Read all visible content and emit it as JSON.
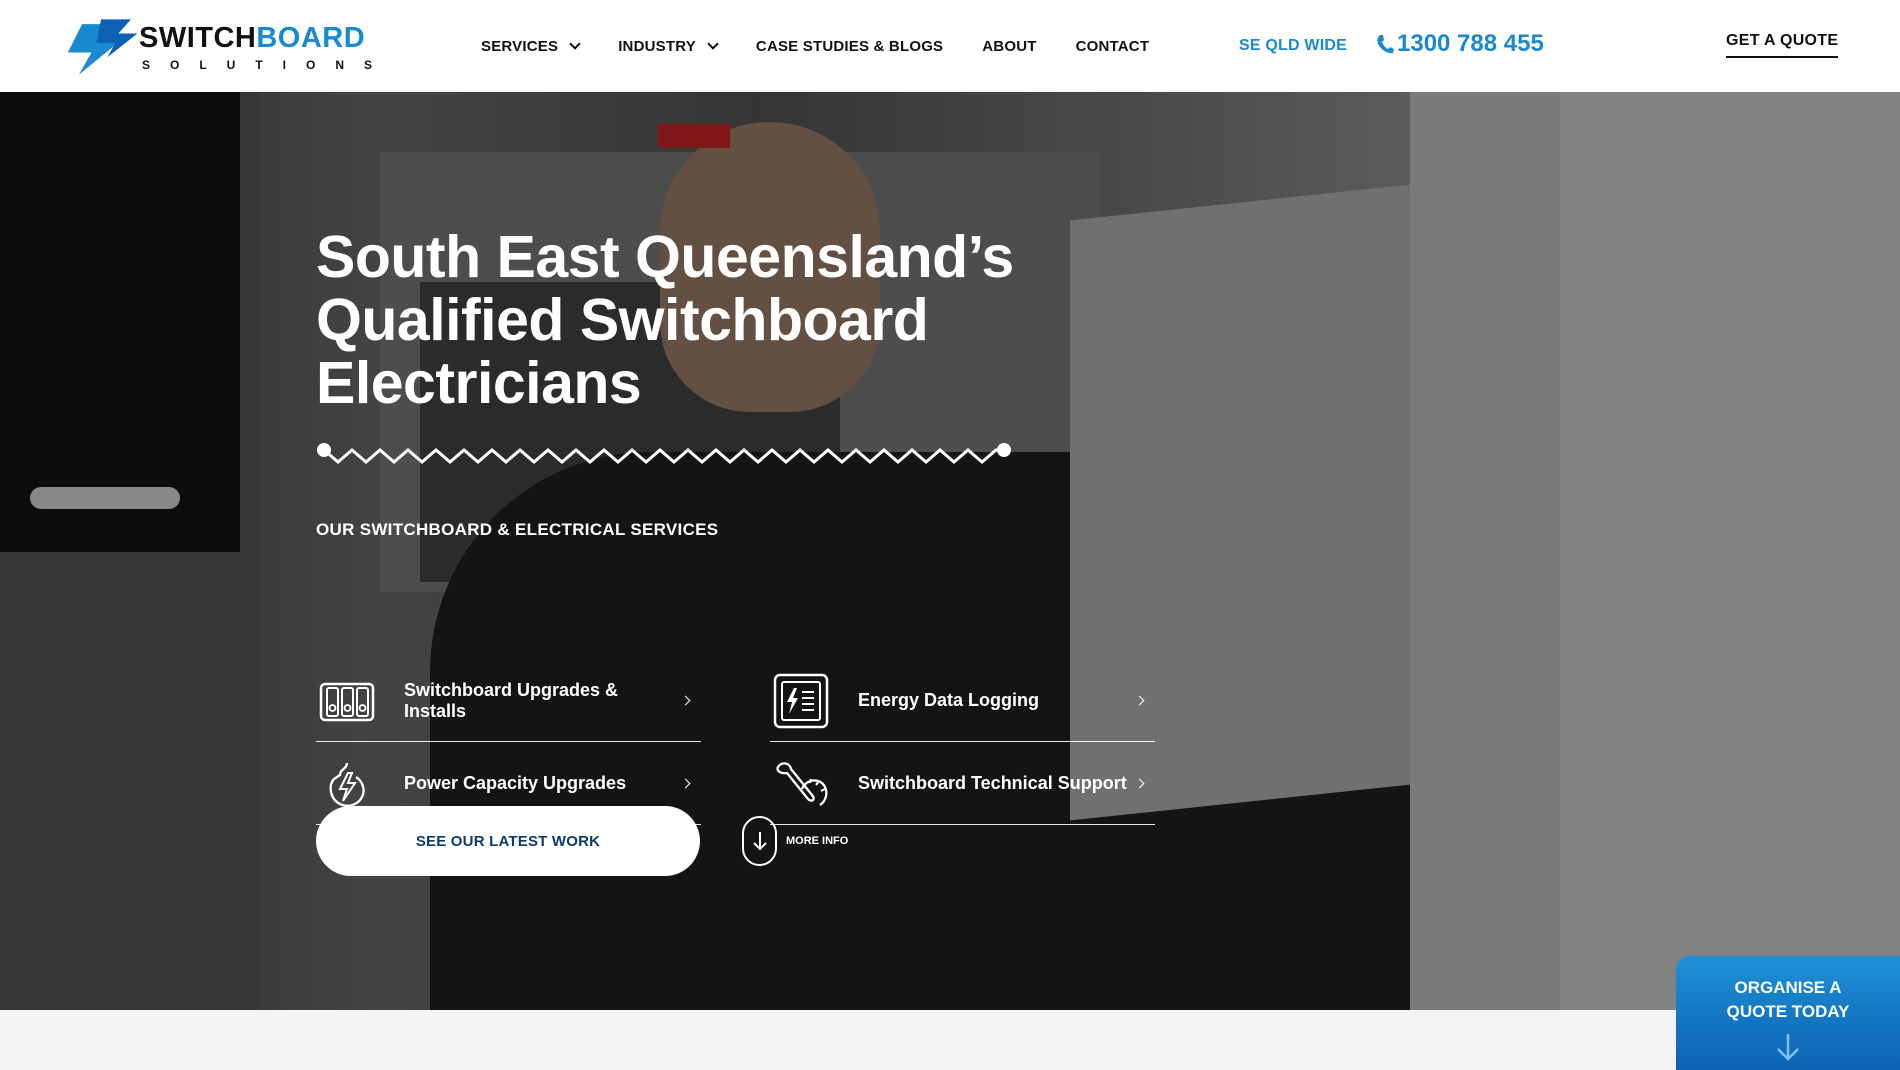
{
  "brand": {
    "name_part1": "SWITCH",
    "name_part2": "BOARD",
    "tagline": "SOLUTIONS",
    "colors": {
      "accent": "#1a8ad0",
      "dark": "#111111",
      "navy": "#0d3a6b"
    }
  },
  "nav": {
    "items": [
      {
        "label": "SERVICES",
        "dropdown": true
      },
      {
        "label": "INDUSTRY",
        "dropdown": true
      },
      {
        "label": "CASE STUDIES & BLOGS",
        "dropdown": false
      },
      {
        "label": "ABOUT",
        "dropdown": false
      },
      {
        "label": "CONTACT",
        "dropdown": false
      }
    ],
    "region": "SE QLD WIDE",
    "phone": "1300 788 455",
    "quote": "GET A QUOTE"
  },
  "hero": {
    "title_line1": "South East Queensland’s",
    "title_line2": "Qualified Switchboard",
    "title_line3": "Electricians",
    "services_heading": "OUR SWITCHBOARD & ELECTRICAL SERVICES",
    "services": [
      {
        "label": "Switchboard Upgrades & Installs",
        "icon": "switchboard-icon"
      },
      {
        "label": "Energy Data Logging",
        "icon": "data-logger-icon"
      },
      {
        "label": "Power Capacity Upgrades",
        "icon": "power-icon"
      },
      {
        "label": "Switchboard Technical Support",
        "icon": "wrench-gauge-icon"
      }
    ],
    "cta": "SEE OUR LATEST WORK",
    "more_info": "MORE INFO"
  },
  "sticky": {
    "label": "ORGANISE A QUOTE TODAY"
  }
}
